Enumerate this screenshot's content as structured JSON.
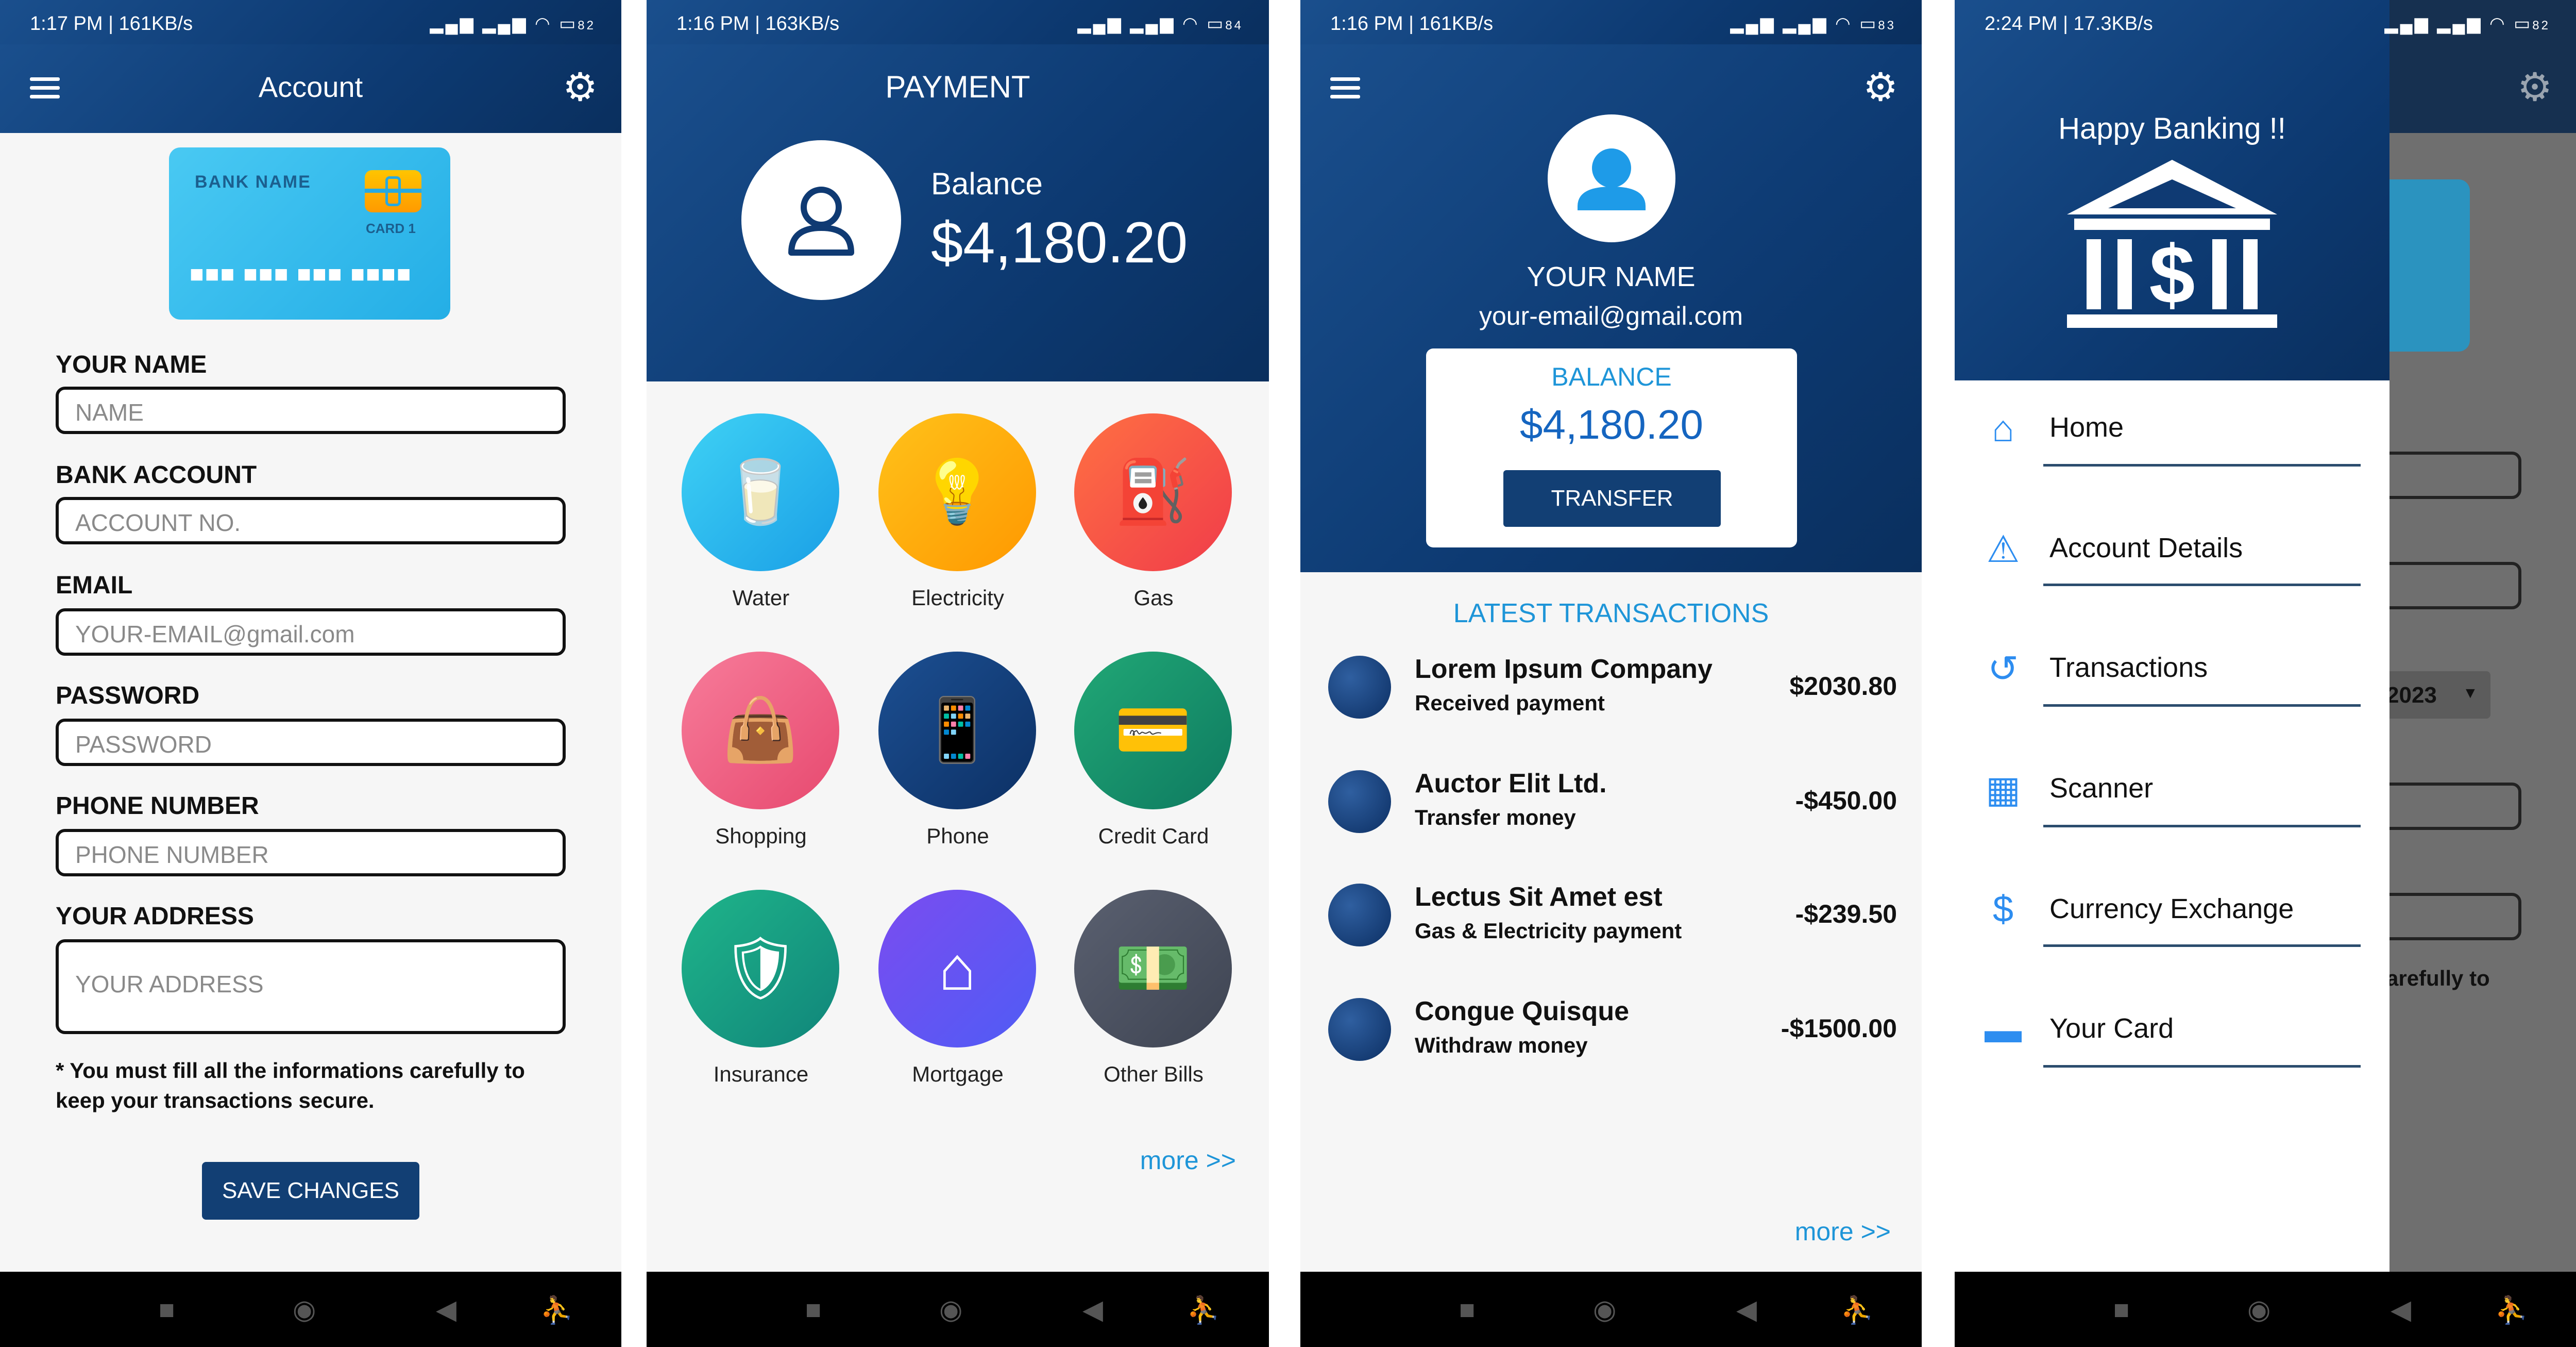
{
  "status_bars": [
    {
      "time": "1:17 PM | 161KB/s",
      "battery": "82"
    },
    {
      "time": "1:16 PM | 163KB/s",
      "battery": "84"
    },
    {
      "time": "1:16 PM | 161KB/s",
      "battery": "83"
    },
    {
      "time": "2:24 PM | 17.3KB/s",
      "battery": "82"
    }
  ],
  "account": {
    "title": "Account",
    "card": {
      "bank_name": "BANK NAME",
      "card_label": "CARD 1",
      "number_mask": "■■■ ■■■ ■■■ ■■■■"
    },
    "fields": [
      {
        "label": "YOUR NAME",
        "placeholder": "NAME"
      },
      {
        "label": "BANK ACCOUNT",
        "placeholder": "ACCOUNT NO."
      },
      {
        "label": "EMAIL",
        "placeholder": "YOUR-EMAIL@gmail.com"
      },
      {
        "label": "PASSWORD",
        "placeholder": "PASSWORD"
      },
      {
        "label": "PHONE NUMBER",
        "placeholder": "PHONE NUMBER"
      },
      {
        "label": "YOUR ADDRESS",
        "placeholder": "YOUR ADDRESS"
      }
    ],
    "notice": "* You must fill all the informations carefully to keep your transactions secure.",
    "save_button": "SAVE CHANGES"
  },
  "payment": {
    "title": "PAYMENT",
    "balance_label": "Balance",
    "balance_value": "$4,180.20",
    "categories": [
      {
        "label": "Water",
        "icon": "water-glass-icon",
        "color_from": "#3fd2f5",
        "color_to": "#1a9fe6"
      },
      {
        "label": "Electricity",
        "icon": "lightbulb-icon",
        "color_from": "#ffc21a",
        "color_to": "#ff9800"
      },
      {
        "label": "Gas",
        "icon": "gas-pump-icon",
        "color_from": "#ff7043",
        "color_to": "#f03c4a"
      },
      {
        "label": "Shopping",
        "icon": "shopping-bag-icon",
        "color_from": "#f77c9a",
        "color_to": "#e7496f"
      },
      {
        "label": "Phone",
        "icon": "smartphone-icon",
        "color_from": "#1c4f92",
        "color_to": "#0c3064"
      },
      {
        "label": "Credit Card",
        "icon": "credit-card-icon",
        "color_from": "#21a876",
        "color_to": "#0e7a60"
      },
      {
        "label": "Insurance",
        "icon": "shield-icon",
        "color_from": "#1fb58a",
        "color_to": "#10857a"
      },
      {
        "label": "Mortgage",
        "icon": "house-icon",
        "color_from": "#7b4cf0",
        "color_to": "#4f5cf5"
      },
      {
        "label": "Other Bills",
        "icon": "cash-icon",
        "color_from": "#5a6070",
        "color_to": "#3e4452"
      }
    ],
    "more_link": "more >>"
  },
  "home": {
    "user_name": "YOUR NAME",
    "user_email": "your-email@gmail.com",
    "balance_label": "BALANCE",
    "balance_value": "$4,180.20",
    "transfer_button": "TRANSFER",
    "transactions_title": "LATEST TRANSACTIONS",
    "transactions": [
      {
        "title": "Lorem Ipsum Company",
        "subtitle": "Received payment",
        "amount": "$2030.80"
      },
      {
        "title": "Auctor Elit Ltd.",
        "subtitle": "Transfer money",
        "amount": "-$450.00"
      },
      {
        "title": "Lectus Sit Amet est",
        "subtitle": "Gas & Electricity payment",
        "amount": "-$239.50"
      },
      {
        "title": "Congue Quisque",
        "subtitle": "Withdraw money",
        "amount": "-$1500.00"
      }
    ],
    "more_link": "more >>"
  },
  "drawer": {
    "header_title": "Happy Banking !!",
    "items": [
      {
        "label": "Home",
        "icon": "home-icon"
      },
      {
        "label": "Account Details",
        "icon": "warning-triangle-icon"
      },
      {
        "label": "Transactions",
        "icon": "history-icon"
      },
      {
        "label": "Scanner",
        "icon": "qr-code-icon"
      },
      {
        "label": "Currency Exchange",
        "icon": "currency-exchange-icon"
      },
      {
        "label": "Your Card",
        "icon": "card-icon"
      }
    ],
    "background_year": "2023",
    "background_text": "arefully to"
  },
  "colors": {
    "primary": "#0f3a73",
    "accent": "#1e95d8",
    "button": "#123f74"
  }
}
